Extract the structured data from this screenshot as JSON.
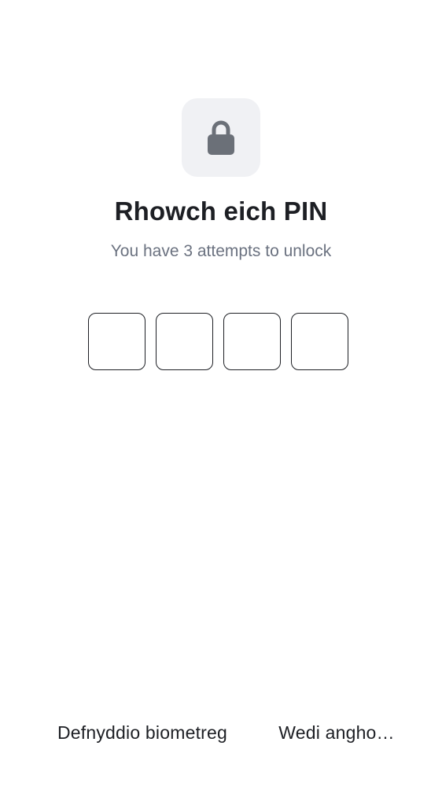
{
  "icons": {
    "lock": "lock-icon"
  },
  "colors": {
    "background": "#ffffff",
    "tile": "#f0f1f4",
    "lock_glyph": "#6b7078",
    "title": "#1d1f24",
    "subtitle": "#6b7280",
    "pin_border": "#1d1f24"
  },
  "header": {
    "title": "Rhowch eich PIN",
    "subtitle": "You have 3 attempts to unlock"
  },
  "pin": {
    "digits": [
      "",
      "",
      "",
      ""
    ]
  },
  "footer": {
    "biometric_label": "Defnyddio biometreg",
    "forgot_label": "Wedi angho…"
  }
}
